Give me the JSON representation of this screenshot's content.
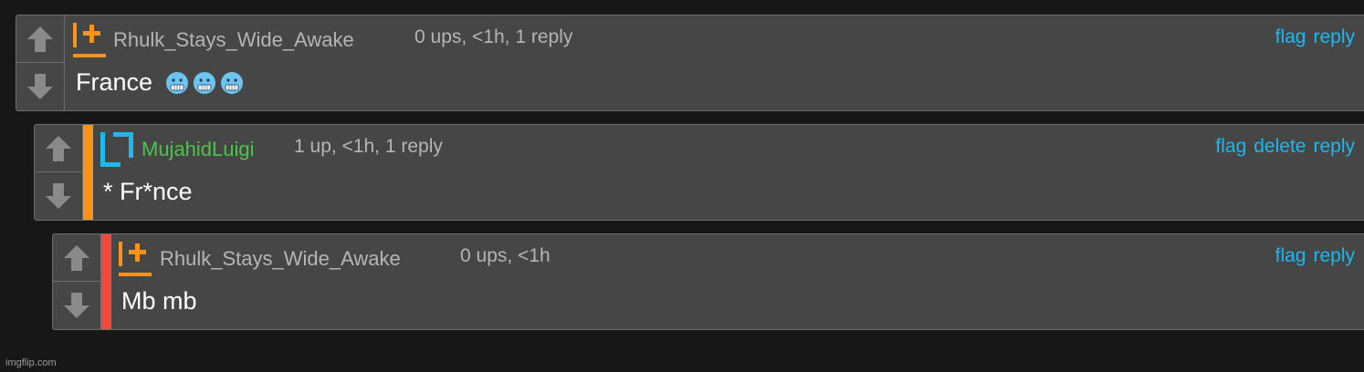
{
  "colors": {
    "background": "#171717",
    "card": "#464646",
    "border": "#6d6d6d",
    "link": "#1cb8f0",
    "username_default": "#b5b5b5",
    "username_green": "#4cc44c",
    "mod_orange": "#f7941d",
    "mod_blue": "#1cb8f0",
    "bar_orange": "#f7941d",
    "bar_red": "#ef4a3c"
  },
  "comments": [
    {
      "username": "Rhulk_Stays_Wide_Awake",
      "badge_icon": "orange-mod-icon",
      "meta": "0 ups, <1h, 1 reply",
      "actions": [
        "flag",
        "reply"
      ],
      "body": "France",
      "emoji": [
        "cold-face-emoji",
        "cold-face-emoji",
        "cold-face-emoji"
      ]
    },
    {
      "username": "MujahidLuigi",
      "badge_icon": "blue-mod-icon",
      "meta": "1 up, <1h, 1 reply",
      "actions": [
        "flag",
        "delete",
        "reply"
      ],
      "body": "* Fr*nce",
      "thread_color": "#f7941d"
    },
    {
      "username": "Rhulk_Stays_Wide_Awake",
      "badge_icon": "orange-mod-icon",
      "meta": "0 ups, <1h",
      "actions": [
        "flag",
        "reply"
      ],
      "body": "Mb mb",
      "thread_color": "#ef4a3c"
    }
  ],
  "watermark": "imgflip.com"
}
